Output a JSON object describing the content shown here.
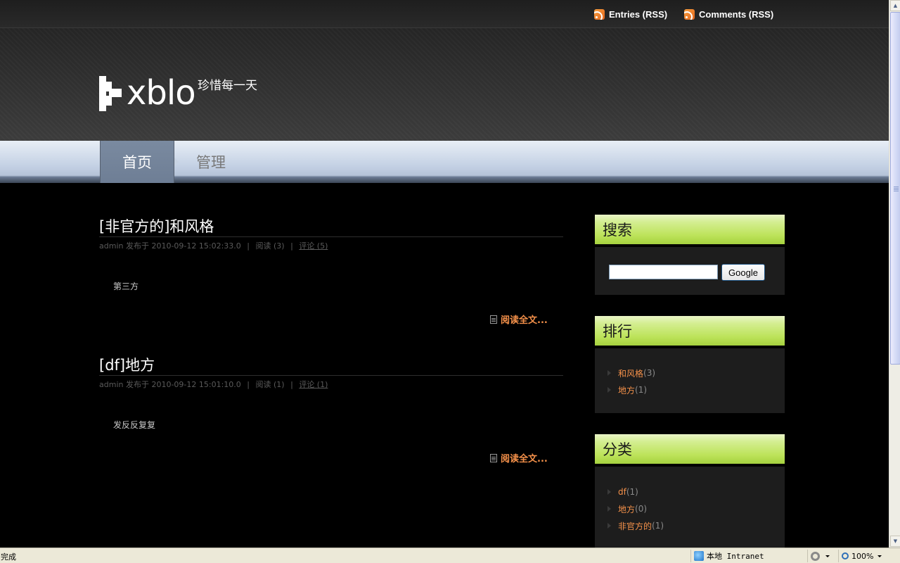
{
  "header": {
    "rss_entries": "Entries (RSS)",
    "rss_comments": "Comments (RSS)",
    "logo_text": "xblo",
    "tagline": "珍惜每一天"
  },
  "nav": {
    "items": [
      {
        "label": "首页",
        "active": true
      },
      {
        "label": "管理",
        "active": false
      }
    ]
  },
  "posts": [
    {
      "title": "[非官方的]和风格",
      "author": "admin",
      "published_prefix": "发布于",
      "datetime": "2010-09-12 15:02:33.0",
      "reads": "阅读 (3)",
      "comments": "评论 (5)",
      "excerpt": "第三方",
      "read_more": "阅读全文..."
    },
    {
      "title": "[df]地方",
      "author": "admin",
      "published_prefix": "发布于",
      "datetime": "2010-09-12 15:01:10.0",
      "reads": "阅读 (1)",
      "comments": "评论 (1)",
      "excerpt": "发反反复复",
      "read_more": "阅读全文..."
    }
  ],
  "sidebar": {
    "search": {
      "title": "搜索",
      "input_value": "",
      "button_label": "Google"
    },
    "ranking": {
      "title": "排行",
      "items": [
        {
          "label": "和风格",
          "count": "(3)"
        },
        {
          "label": "地方",
          "count": "(1)"
        }
      ]
    },
    "categories": {
      "title": "分类",
      "items": [
        {
          "label": "df",
          "count": "(1)"
        },
        {
          "label": "地方",
          "count": "(0)"
        },
        {
          "label": "非官方的",
          "count": "(1)"
        }
      ]
    }
  },
  "statusbar": {
    "status": "完成",
    "zone": "本地 Intranet",
    "zoom": "100%"
  },
  "colors": {
    "accent_link": "#f5914a",
    "widget_header": "#bde35a",
    "nav_active": "#7a8aa0"
  }
}
